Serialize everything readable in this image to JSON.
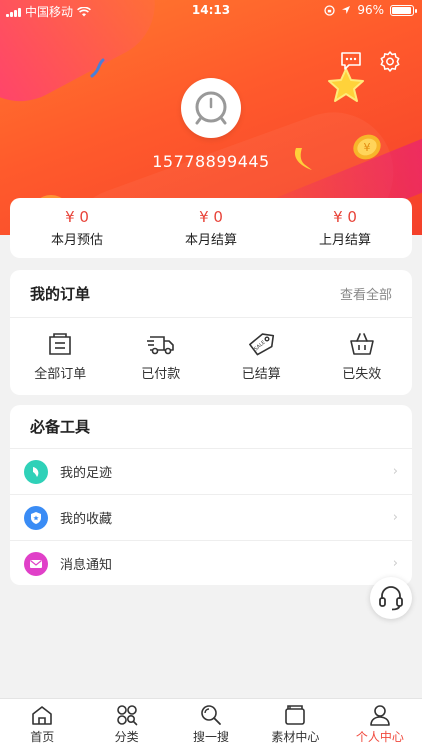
{
  "status_bar": {
    "carrier": "中国移动",
    "time": "14:13",
    "battery": "96%",
    "battery_level": 0.96
  },
  "header": {
    "message_icon": "message-icon",
    "settings_icon": "gear-icon",
    "avatar_icon": "clock-avatar-icon",
    "phone": "15778899445"
  },
  "stats": [
    {
      "amount": "¥ 0",
      "label": "本月预估"
    },
    {
      "amount": "¥ 0",
      "label": "本月结算"
    },
    {
      "amount": "¥ 0",
      "label": "上月结算"
    }
  ],
  "orders": {
    "title": "我的订单",
    "view_all": "查看全部",
    "items": [
      {
        "label": "全部订单",
        "icon": "order-list-icon"
      },
      {
        "label": "已付款",
        "icon": "truck-icon"
      },
      {
        "label": "已结算",
        "icon": "sale-tag-icon"
      },
      {
        "label": "已失效",
        "icon": "basket-icon"
      }
    ]
  },
  "tools": {
    "title": "必备工具",
    "items": [
      {
        "label": "我的足迹",
        "icon": "footprint-icon",
        "color": "#2fd1b8"
      },
      {
        "label": "我的收藏",
        "icon": "shield-icon",
        "color": "#3a8cf5"
      },
      {
        "label": "消息通知",
        "icon": "mail-icon",
        "color": "#e040c8"
      }
    ]
  },
  "tabbar": {
    "items": [
      {
        "label": "首页",
        "icon": "home-icon"
      },
      {
        "label": "分类",
        "icon": "category-icon"
      },
      {
        "label": "搜一搜",
        "icon": "search-icon"
      },
      {
        "label": "素材中心",
        "icon": "material-icon"
      },
      {
        "label": "个人中心",
        "icon": "person-icon"
      }
    ],
    "active_index": 4,
    "active_color": "#f04a3e"
  },
  "colors": {
    "accent": "#e8443a",
    "header_start": "#ff7a2e",
    "header_end": "#f4402a"
  }
}
